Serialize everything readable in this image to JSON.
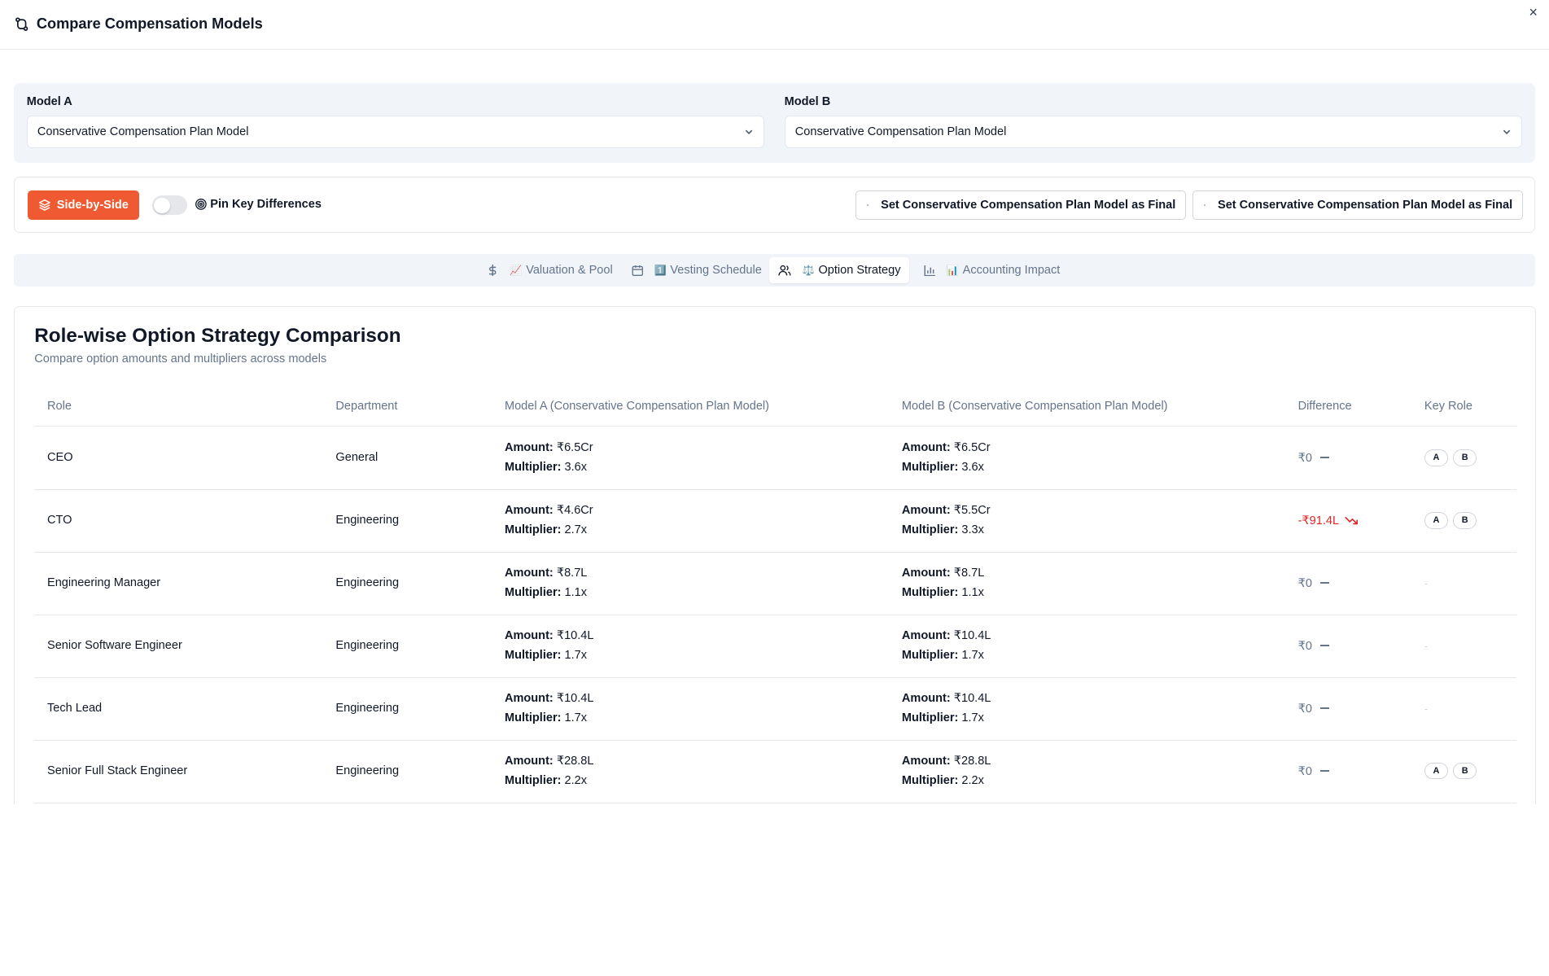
{
  "dialog": {
    "title": "Compare Compensation Models",
    "close_glyph": "×"
  },
  "models": {
    "a": {
      "label": "Model A",
      "value": "Conservative Compensation Plan Model"
    },
    "b": {
      "label": "Model B",
      "value": "Conservative Compensation Plan Model"
    }
  },
  "toolbar": {
    "side_by_side_label": "Side-by-Side",
    "pin_label": "Pin Key Differences",
    "pin_enabled": false,
    "final_a_label": "Set Conservative Compensation Plan Model as Final",
    "final_b_label": "Set Conservative Compensation Plan Model as Final",
    "accent_color": "#ef5a33"
  },
  "tabs": [
    {
      "label": "Valuation & Pool",
      "emoji": "📈",
      "icon": "dollar-icon"
    },
    {
      "label": "Vesting Schedule",
      "emoji": "1️⃣",
      "icon": "calendar-icon"
    },
    {
      "label": "Option Strategy",
      "emoji": "⚖️",
      "icon": "users-icon",
      "active": true
    },
    {
      "label": "Accounting Impact",
      "emoji": "📊",
      "icon": "bar-chart-icon"
    }
  ],
  "section": {
    "title": "Role-wise Option Strategy Comparison",
    "subtitle": "Compare option amounts and multipliers across models"
  },
  "table": {
    "columns": [
      "Role",
      "Department",
      "Model A (Conservative Compensation Plan Model)",
      "Model B (Conservative Compensation Plan Model)",
      "Difference",
      "Key Role"
    ],
    "amount_label": "Amount:",
    "multiplier_label": "Multiplier:",
    "rows": [
      {
        "role": "CEO",
        "department": "General",
        "a_amount": "₹6.5Cr",
        "a_mult": "3.6x",
        "b_amount": "₹6.5Cr",
        "b_mult": "3.6x",
        "difference": "₹0",
        "trend": "flat",
        "key_a": "A",
        "key_b": "B"
      },
      {
        "role": "CTO",
        "department": "Engineering",
        "a_amount": "₹4.6Cr",
        "a_mult": "2.7x",
        "b_amount": "₹5.5Cr",
        "b_mult": "3.3x",
        "difference": "-₹91.4L",
        "trend": "down",
        "key_a": "A",
        "key_b": "B"
      },
      {
        "role": "Engineering Manager",
        "department": "Engineering",
        "a_amount": "₹8.7L",
        "a_mult": "1.1x",
        "b_amount": "₹8.7L",
        "b_mult": "1.1x",
        "difference": "₹0",
        "trend": "flat",
        "key_none": "-"
      },
      {
        "role": "Senior Software Engineer",
        "department": "Engineering",
        "a_amount": "₹10.4L",
        "a_mult": "1.7x",
        "b_amount": "₹10.4L",
        "b_mult": "1.7x",
        "difference": "₹0",
        "trend": "flat",
        "key_none": "-"
      },
      {
        "role": "Tech Lead",
        "department": "Engineering",
        "a_amount": "₹10.4L",
        "a_mult": "1.7x",
        "b_amount": "₹10.4L",
        "b_mult": "1.7x",
        "difference": "₹0",
        "trend": "flat",
        "key_none": "-"
      },
      {
        "role": "Senior Full Stack Engineer",
        "department": "Engineering",
        "a_amount": "₹28.8L",
        "a_mult": "2.2x",
        "b_amount": "₹28.8L",
        "b_mult": "2.2x",
        "difference": "₹0",
        "trend": "flat",
        "key_a": "A",
        "key_b": "B"
      }
    ]
  }
}
